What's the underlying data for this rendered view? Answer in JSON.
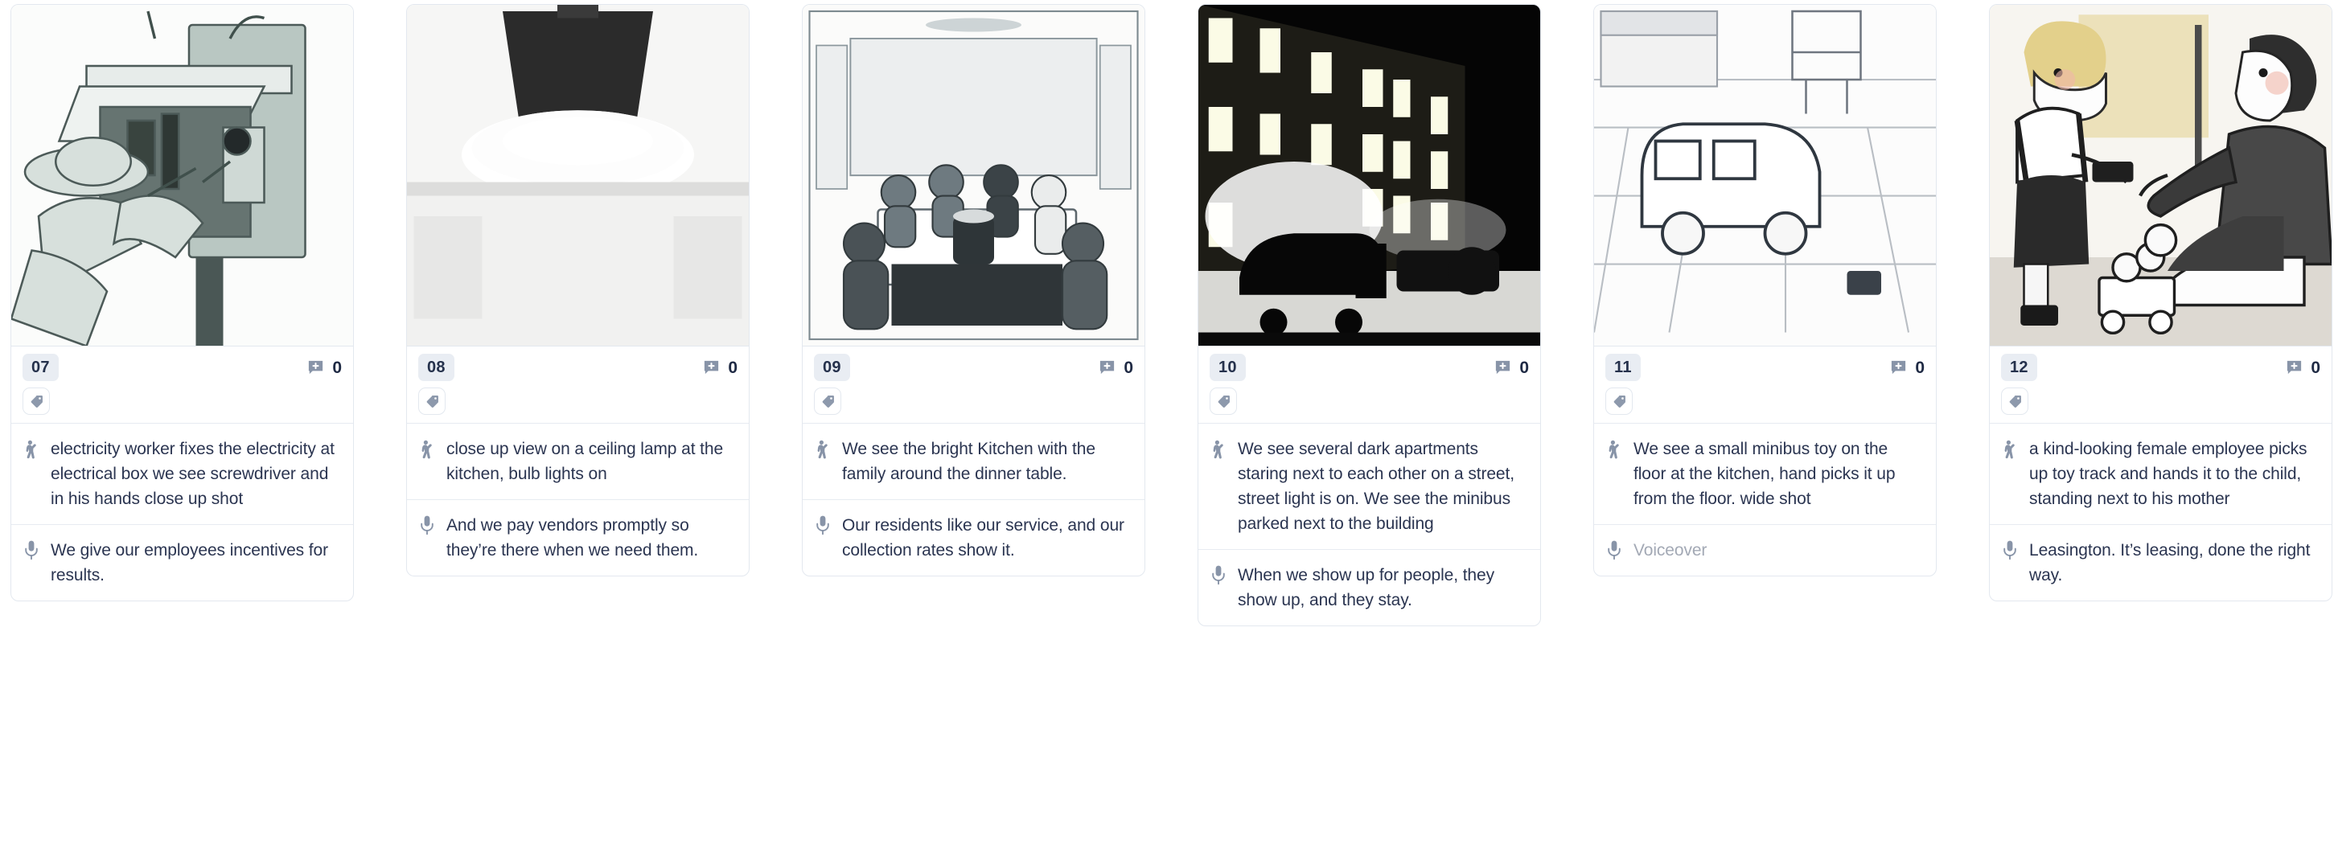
{
  "board": {
    "cards": [
      {
        "shot_number": "07",
        "comment_count": "0",
        "comment_icon": "comment-plus-icon",
        "tag_icon": "tag-icon",
        "action_icon": "action-figure-icon",
        "voiceover_icon": "microphone-icon",
        "action": "electricity worker fixes the electricity at electrical box we see screwdriver and in his hands close up shot",
        "voiceover": "We give our employees incentives for results.",
        "voiceover_is_placeholder": false,
        "image_alt": "sketch of an electricity worker in a hat repairing an open electrical box with a screwdriver"
      },
      {
        "shot_number": "08",
        "comment_count": "0",
        "comment_icon": "comment-plus-icon",
        "tag_icon": "tag-icon",
        "action_icon": "action-figure-icon",
        "voiceover_icon": "microphone-icon",
        "action": "close up view on a ceiling lamp at the kitchen, bulb lights on",
        "voiceover": "And we pay vendors promptly so they’re there when we need them.",
        "voiceover_is_placeholder": false,
        "image_alt": "close up greyscale sketch of a conical ceiling lamp glowing"
      },
      {
        "shot_number": "09",
        "comment_count": "0",
        "comment_icon": "comment-plus-icon",
        "tag_icon": "tag-icon",
        "action_icon": "action-figure-icon",
        "voiceover_icon": "microphone-icon",
        "action": "We see the bright Kitchen with the family around the dinner table.",
        "voiceover": "Our residents like our service, and our collection rates show it.",
        "voiceover_is_placeholder": false,
        "image_alt": "sketch of a bright kitchen with a family seated around a dinner table"
      },
      {
        "shot_number": "10",
        "comment_count": "0",
        "comment_icon": "comment-plus-icon",
        "tag_icon": "tag-icon",
        "action_icon": "action-figure-icon",
        "voiceover_icon": "microphone-icon",
        "action": "We see several dark apartments staring next to each other on a street, street light is on. We see the minibus parked next to the building",
        "voiceover": "When we show up for people, they show up, and they stay.",
        "voiceover_is_placeholder": false,
        "image_alt": "night photo of an apartment block with lit windows and a van parked on the street"
      },
      {
        "shot_number": "11",
        "comment_count": "0",
        "comment_icon": "comment-plus-icon",
        "tag_icon": "tag-icon",
        "action_icon": "action-figure-icon",
        "voiceover_icon": "microphone-icon",
        "action": "We see a small minibus toy on the floor at the kitchen, hand picks it up from the floor. wide shot",
        "voiceover": "Voiceover",
        "voiceover_is_placeholder": true,
        "image_alt": "line sketch of a toy minibus on a kitchen floor"
      },
      {
        "shot_number": "12",
        "comment_count": "0",
        "comment_icon": "comment-plus-icon",
        "tag_icon": "tag-icon",
        "action_icon": "action-figure-icon",
        "voiceover_icon": "microphone-icon",
        "action": "a kind-looking female employee picks up toy track and hands it to the child, standing next to his mother",
        "voiceover": "Leasington. It’s leasing, done the right way.",
        "voiceover_is_placeholder": false,
        "image_alt": "illustration of a woman kneeling and handing a toy to a small boy with a toy wagon"
      }
    ]
  },
  "colors": {
    "card_border": "#e3e8ef",
    "badge_bg": "#e9edf3",
    "text": "#2b3551",
    "icon": "#8894a8",
    "placeholder": "#a3a9b5"
  }
}
